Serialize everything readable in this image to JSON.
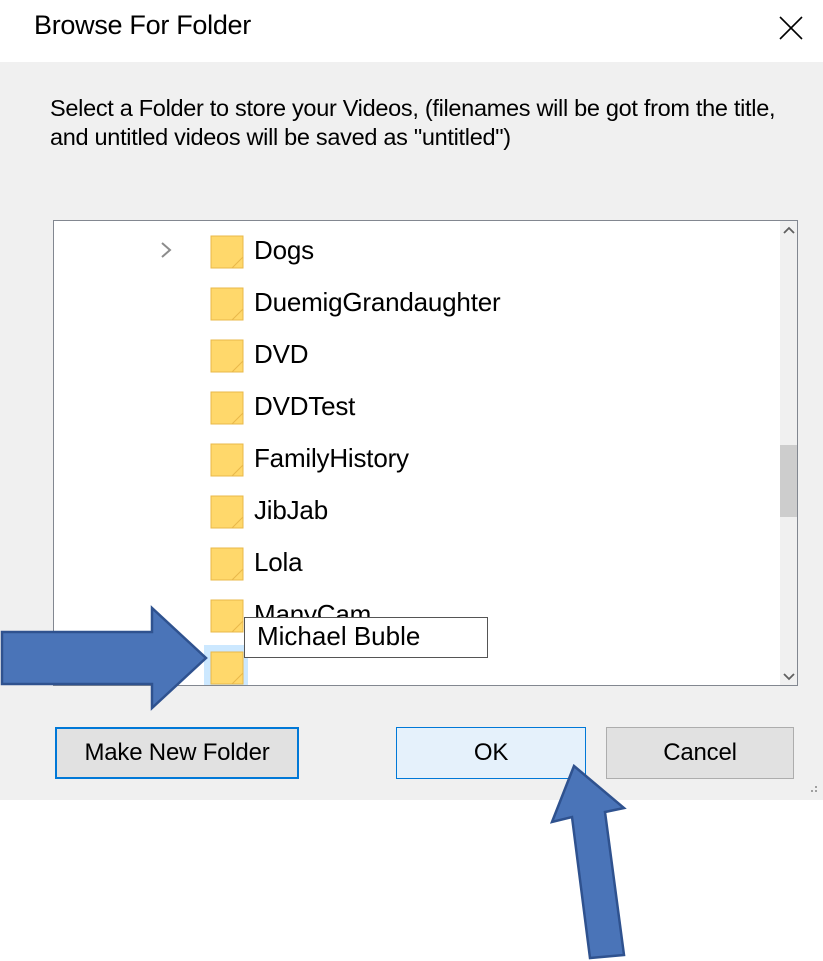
{
  "window": {
    "title": "Browse For Folder",
    "close_icon": "close-icon"
  },
  "instruction": "Select a Folder to store your Videos, (filenames will be got from the title, and untitled videos will be saved as \"untitled\")",
  "folders": [
    {
      "label": "Dogs",
      "has_children": true
    },
    {
      "label": "DuemigGrandaughter",
      "has_children": false
    },
    {
      "label": "DVD",
      "has_children": false
    },
    {
      "label": "DVDTest",
      "has_children": false
    },
    {
      "label": "FamilyHistory",
      "has_children": false
    },
    {
      "label": "JibJab",
      "has_children": false
    },
    {
      "label": "Lola",
      "has_children": false
    },
    {
      "label": "ManyCam",
      "has_children": false
    },
    {
      "label": "Michael Buble",
      "has_children": false,
      "editing": true
    }
  ],
  "buttons": {
    "make_new_folder": "Make New Folder",
    "ok": "OK",
    "cancel": "Cancel"
  },
  "colors": {
    "selection": "#cce8ff",
    "focus_border": "#0078d7",
    "folder_fill": "#ffd86b",
    "annotation_arrow": "#4a74b8"
  },
  "annotations": {
    "arrow_icons": [
      "right-arrow-icon",
      "up-arrow-icon"
    ]
  }
}
